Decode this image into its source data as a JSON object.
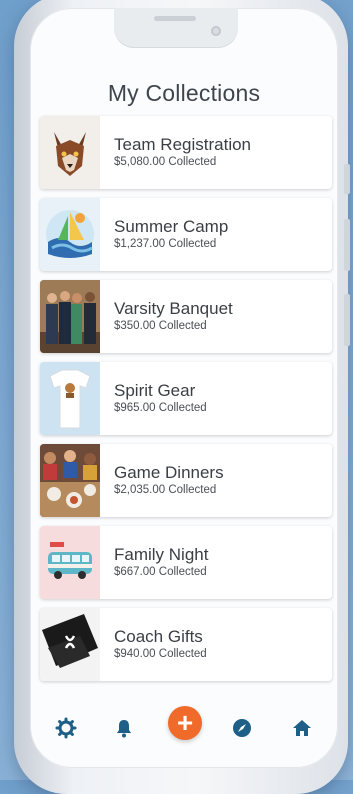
{
  "header": {
    "title": "My Collections"
  },
  "collections": [
    {
      "title": "Team Registration",
      "amount": "$5,080.00 Collected",
      "thumb_icon": "wolf-mascot-icon"
    },
    {
      "title": "Summer Camp",
      "amount": "$1,237.00 Collected",
      "thumb_icon": "sailboat-logo-icon"
    },
    {
      "title": "Varsity Banquet",
      "amount": "$350.00 Collected",
      "thumb_icon": "banquet-photo"
    },
    {
      "title": "Spirit Gear",
      "amount": "$965.00 Collected",
      "thumb_icon": "tshirt-photo"
    },
    {
      "title": "Game Dinners",
      "amount": "$2,035.00 Collected",
      "thumb_icon": "dinner-photo"
    },
    {
      "title": "Family Night",
      "amount": "$667.00 Collected",
      "thumb_icon": "bus-illustration"
    },
    {
      "title": "Coach Gifts",
      "amount": "$940.00 Collected",
      "thumb_icon": "gift-card-photo"
    }
  ],
  "tabbar": {
    "add_label": "+",
    "icons": [
      "settings-icon",
      "bell-icon",
      "add-icon",
      "compass-icon",
      "home-icon"
    ],
    "accent_color": "#f06a2a",
    "icon_color": "#1d5f86"
  }
}
